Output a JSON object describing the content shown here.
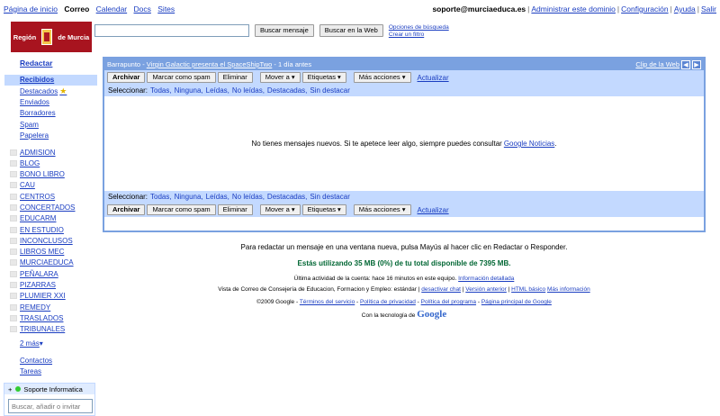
{
  "topbar": {
    "left": [
      "Página de inicio",
      "Correo",
      "Calendar",
      "Docs",
      "Sites"
    ],
    "email": "soporte@murciaeduca.es",
    "right": [
      "Administrar este dominio",
      "Configuración",
      "Ayuda",
      "Salir"
    ]
  },
  "logo": {
    "left": "Región",
    "right": "de Murcia"
  },
  "search": {
    "value": "",
    "btn_mail": "Buscar mensaje",
    "btn_web": "Buscar en la Web",
    "opt1": "Opciones de búsqueda",
    "opt2": "Crear un filtro"
  },
  "nav": {
    "compose": "Redactar",
    "inbox": "Recibidos",
    "system": [
      "Destacados",
      "Enviados",
      "Borradores",
      "Spam",
      "Papelera"
    ],
    "labels": [
      "ADMISION",
      "BLOG",
      "BONO LIBRO",
      "CAU",
      "CENTROS",
      "CONCERTADOS",
      "EDUCARM",
      "EN ESTUDIO",
      "INCONCLUSOS",
      "LIBROS MEC",
      "MURCIAEDUCA",
      "PEÑALARA",
      "PIZARRAS",
      "PLUMIER XXI",
      "REMEDY",
      "TRASLADOS",
      "TRIBUNALES"
    ],
    "more": "2 más",
    "contacts": "Contactos",
    "tasks": "Tareas"
  },
  "chat": {
    "name": "Soporte Informatica",
    "placeholder": "Buscar, añadir o invitar"
  },
  "webclip": {
    "source": "Barrapunto - ",
    "headline": "Virgin Galactic presenta el SpaceShipTwo",
    "age": " - 1 día antes",
    "label": "Clip de la Web"
  },
  "toolbar": {
    "archive": "Archivar",
    "spam": "Marcar como spam",
    "delete": "Eliminar",
    "move": "Mover a ▾",
    "labels": "Etiquetas ▾",
    "more": "Más acciones ▾",
    "refresh": "Actualizar"
  },
  "select": {
    "label": "Seleccionar:",
    "options": [
      "Todas,",
      "Ninguna,",
      "Leídas,",
      "No leídas,",
      "Destacadas,",
      "Sin destacar"
    ]
  },
  "empty": {
    "text": "No tienes mensajes nuevos. Si te apetece leer algo, siempre puedes consultar ",
    "link": "Google Noticias",
    "end": "."
  },
  "footer": {
    "tip": "Para redactar un mensaje en una ventana nueva, pulsa Mayús al hacer clic en Redactar o Responder.",
    "storage": "Estás utilizando 35 MB (0%) de tu total disponible de 7395 MB.",
    "activity": "Última actividad de la cuenta: hace 16 minutos en este equipo.",
    "activity_link": "Información detallada",
    "view": "Vista de Correo de Consejería de Educacion, Formacion y Empleo: estándar |",
    "view_links": [
      "desactivar chat",
      "Versión anterior",
      "HTML básico",
      "Más información"
    ],
    "copyright": "©2009 Google -",
    "legal_links": [
      "Términos del servicio",
      "Política de privacidad",
      "Política del programa",
      "Página principal de Google"
    ],
    "powered": "Con la tecnología de",
    "google": "Google"
  },
  "colors": {
    "accent": "#7aa1e0",
    "toolbar": "#c3d9ff",
    "link": "#1a3dc1",
    "storage": "#006633",
    "logo": "#a8141f"
  }
}
